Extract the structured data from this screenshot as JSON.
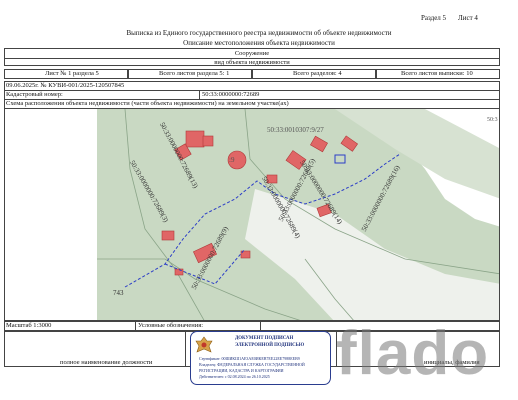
{
  "header": {
    "section": "Раздел 5",
    "sheet": "Лист 4"
  },
  "title": "Выписка из Единого государственного реестра недвижимости об объекте недвижимости",
  "subtitle": "Описание местоположения объекта недвижимости",
  "object": {
    "type": "Сооружение",
    "type_caption": "вид объекта недвижимости"
  },
  "sheet_row": {
    "sheet": "Лист № 1 раздела 5",
    "total_in_section": "Всего листов раздела 5: 1",
    "total_sections": "Всего разделов: 4",
    "total_sheets": "Всего листов выписки: 10"
  },
  "date_number": "09.06.2025г. № КУВИ-001/2025-120507845",
  "cadastral": {
    "label": "Кадастровый номер:",
    "value": "50:33:0000000:72689"
  },
  "scheme_caption": "Схема расположения объекта недвижимости (части объекта недвижимости) на земельном участке(ах)",
  "map_labels": {
    "parcel_top": "50:33:0010307:9/27",
    "parcel_9": ":9",
    "line_a": "50:33:0000000:72689(3)",
    "line_b": "50:33:0000000:72689(4)",
    "line_c": "50:33:0000000:72689(5)",
    "line_d": "50:33:0000000:72689(14)",
    "line_e": "50:33:0000000:72689(16)",
    "line_f": "50:33:0000000:72689(13)",
    "line_g": "50:33:0000000:72689(9)",
    "plot_743": "743",
    "edge_50": "50:3"
  },
  "scale": "Масштаб 1:3000",
  "legend_label": "Условные обозначения:",
  "stamp": {
    "title": "ДОКУМЕНТ ПОДПИСАН",
    "subtitle": "ЭЛЕКТРОННОЙ ПОДПИСЬЮ",
    "cert": "Сертификат: 00ШИКШ1АЕ3АЕ0ИКЕВ7ЕЕ22ЕЕ7988ЕЕВ9",
    "owner": "Владелец: ФЕДЕРАЛЬНАЯ СЛУЖБА ГОСУДАРСТВЕННОЙ",
    "owner2": "РЕГИСТРАЦИИ, КАДАСТРА И КАРТОГРАФИИ",
    "valid": "Действителен: с 02.08.2024 по 26.10.2025"
  },
  "footer": {
    "position": "полное наименование должности",
    "name": "инициалы, фамилия"
  },
  "watermark": "flado",
  "colors": {
    "map_bg": "#c9d9c3",
    "road": "#ececec",
    "building": "#e06666",
    "line": "#2b3dc7",
    "border": "#444444"
  }
}
